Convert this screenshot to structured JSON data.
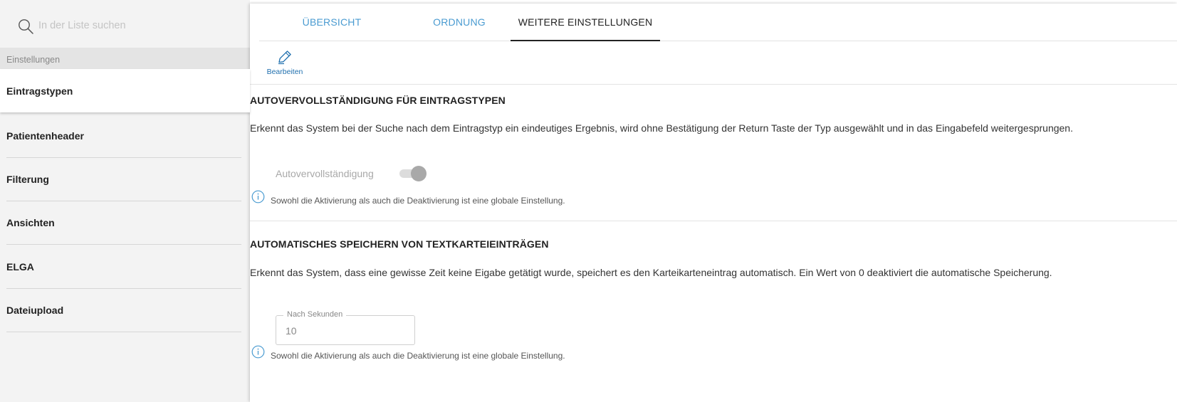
{
  "sidebar": {
    "search_placeholder": "In der Liste suchen",
    "section_header": "Einstellungen",
    "items": [
      {
        "label": "Eintragstypen",
        "active": true
      },
      {
        "label": "Patientenheader",
        "active": false
      },
      {
        "label": "Filterung",
        "active": false
      },
      {
        "label": "Ansichten",
        "active": false
      },
      {
        "label": "ELGA",
        "active": false
      },
      {
        "label": "Dateiupload",
        "active": false
      }
    ]
  },
  "tabs": [
    {
      "label": "ÜBERSICHT",
      "active": false
    },
    {
      "label": "ORDNUNG",
      "active": false
    },
    {
      "label": "WEITERE EINSTELLUNGEN",
      "active": true
    }
  ],
  "toolbar": {
    "edit_label": "Bearbeiten",
    "edit_icon": "pencil-icon"
  },
  "autocomplete": {
    "title": "AUTOVERVOLLSTÄNDIGUNG FÜR EINTRAGSTYPEN",
    "description": "Erkennt das System bei der Suche nach dem Eintragstyp ein eindeutiges Ergebnis, wird ohne Bestätigung der Return Taste der Typ ausgewählt und in das Eingabefeld weitergesprungen.",
    "toggle_label": "Autovervollständigung",
    "toggle_state": "disabled",
    "info": "Sowohl die Aktivierung als auch die Deaktivierung ist eine globale Einstellung."
  },
  "autosave": {
    "title": "AUTOMATISCHES SPEICHERN VON TEXTKARTEIEINTRÄGEN",
    "description": "Erkennt das System, dass eine gewisse Zeit keine Eigabe getätigt wurde, speichert es den Karteikarteneintrag automatisch. Ein Wert von 0 deaktiviert die automatische Speicherung.",
    "field_label": "Nach Sekunden",
    "field_value": "10",
    "info": "Sowohl die Aktivierung als auch die Deaktivierung ist eine globale Einstellung."
  },
  "colors": {
    "accent": "#4a9bd1",
    "edit_blue": "#1f6fae",
    "sidebar_bg": "#f3f3f3"
  }
}
